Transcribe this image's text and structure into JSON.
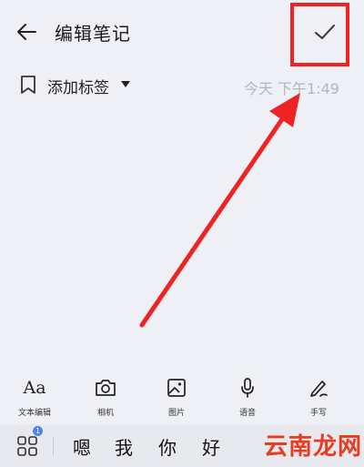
{
  "header": {
    "title": "编辑笔记",
    "back_icon": "arrow-left-icon",
    "confirm_icon": "check-icon"
  },
  "tag_row": {
    "add_tag_label": "添加标签",
    "bookmark_icon": "bookmark-icon",
    "timestamp": "今天 下午1:49"
  },
  "toolbar": {
    "items": [
      {
        "icon": "text-format-icon",
        "glyph": "Aa",
        "label": "文本编辑"
      },
      {
        "icon": "camera-icon",
        "label": "相机"
      },
      {
        "icon": "image-icon",
        "label": "图片"
      },
      {
        "icon": "microphone-icon",
        "label": "语音"
      },
      {
        "icon": "handwriting-icon",
        "label": "手写"
      }
    ]
  },
  "keyboard": {
    "grid_icon": "grid-icon",
    "badge": "1",
    "candidates": [
      "嗯",
      "我",
      "你",
      "好"
    ]
  },
  "watermark": "云南龙网",
  "colors": {
    "highlight": "#ee2424",
    "background": "#eef0f5"
  }
}
